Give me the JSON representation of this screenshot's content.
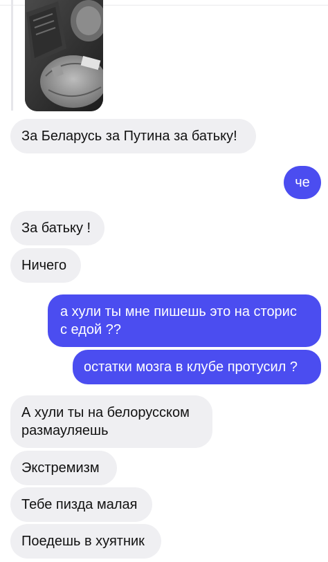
{
  "messages": [
    {
      "from": "them",
      "text": "За Беларусь за Путина за батьку!"
    },
    {
      "from": "me",
      "text": "че"
    },
    {
      "from": "them",
      "text": "За батьку !"
    },
    {
      "from": "them",
      "text": "Ничего"
    },
    {
      "from": "me",
      "lines": [
        "а хули ты мне пишешь это на сторис",
        "с едой ??"
      ]
    },
    {
      "from": "me",
      "text": "остатки мозга в клубе протусил ?"
    },
    {
      "from": "them",
      "lines": [
        "А хули ты на белорусском",
        "размауляешь"
      ]
    },
    {
      "from": "them",
      "text": "Экстремизм"
    },
    {
      "from": "them",
      "text": "Тебе пизда малая"
    },
    {
      "from": "them",
      "text": "Поедешь в хуятник"
    }
  ],
  "story": {
    "icon": "story-photo"
  },
  "colors": {
    "incoming_bubble": "#efeff2",
    "outgoing_bubble": "#4b4df0",
    "text_dark": "#111111",
    "text_light": "#ffffff"
  }
}
